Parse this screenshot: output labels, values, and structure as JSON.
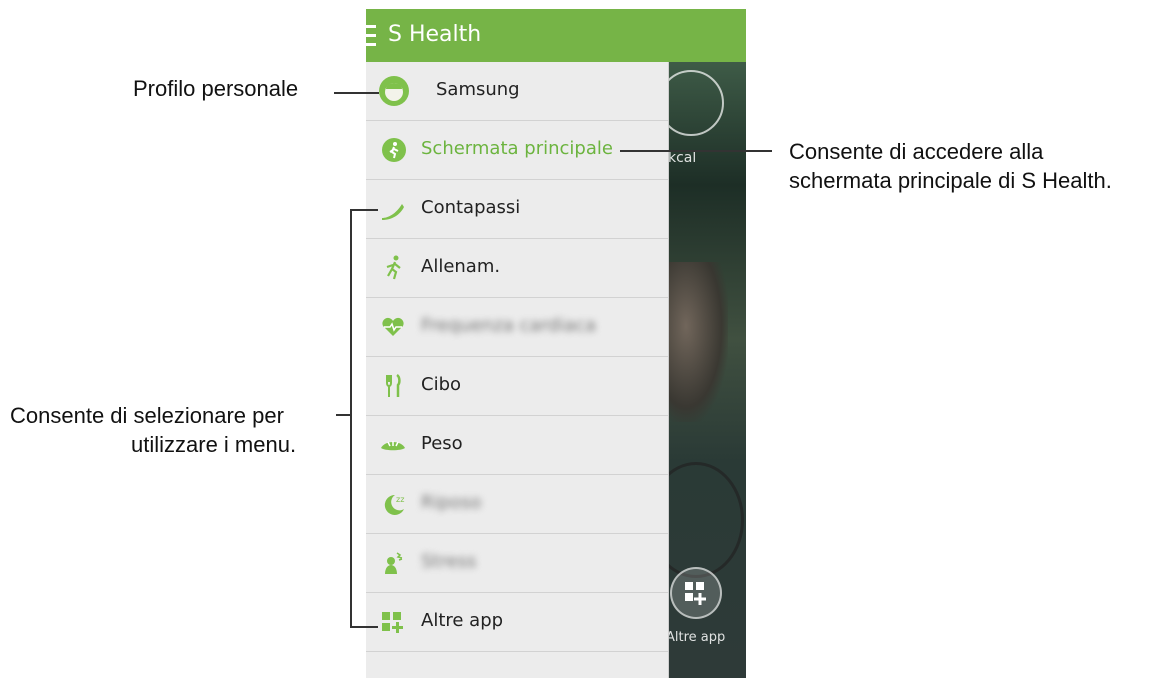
{
  "app": {
    "title": "S Health"
  },
  "menu": [
    {
      "label": "Samsung",
      "icon": "profile-avatar-icon"
    },
    {
      "label": "Schermata principale",
      "icon": "home-runner-icon"
    },
    {
      "label": "Contapassi",
      "icon": "shoe-icon"
    },
    {
      "label": "Allenam.",
      "icon": "running-icon"
    },
    {
      "label": "Frequenza cardiaca",
      "icon": "heart-rate-icon"
    },
    {
      "label": "Cibo",
      "icon": "fork-knife-icon"
    },
    {
      "label": "Peso",
      "icon": "scale-icon"
    },
    {
      "label": "Riposo",
      "icon": "sleep-moon-icon"
    },
    {
      "label": "Stress",
      "icon": "stress-icon"
    },
    {
      "label": "Altre app",
      "icon": "grid-plus-icon"
    }
  ],
  "background": {
    "kcal_label": "kcal",
    "altre_label": "Altre app"
  },
  "callouts": {
    "profile": "Profilo personale",
    "home_line1": "Consente di accedere alla",
    "home_line2": "schermata principale di S Health.",
    "menus_line1": "Consente di selezionare per",
    "menus_line2": "utilizzare i menu."
  },
  "colors": {
    "accent": "#76b447",
    "active_text": "#6cb43f",
    "icon_green": "#7fc14b"
  }
}
